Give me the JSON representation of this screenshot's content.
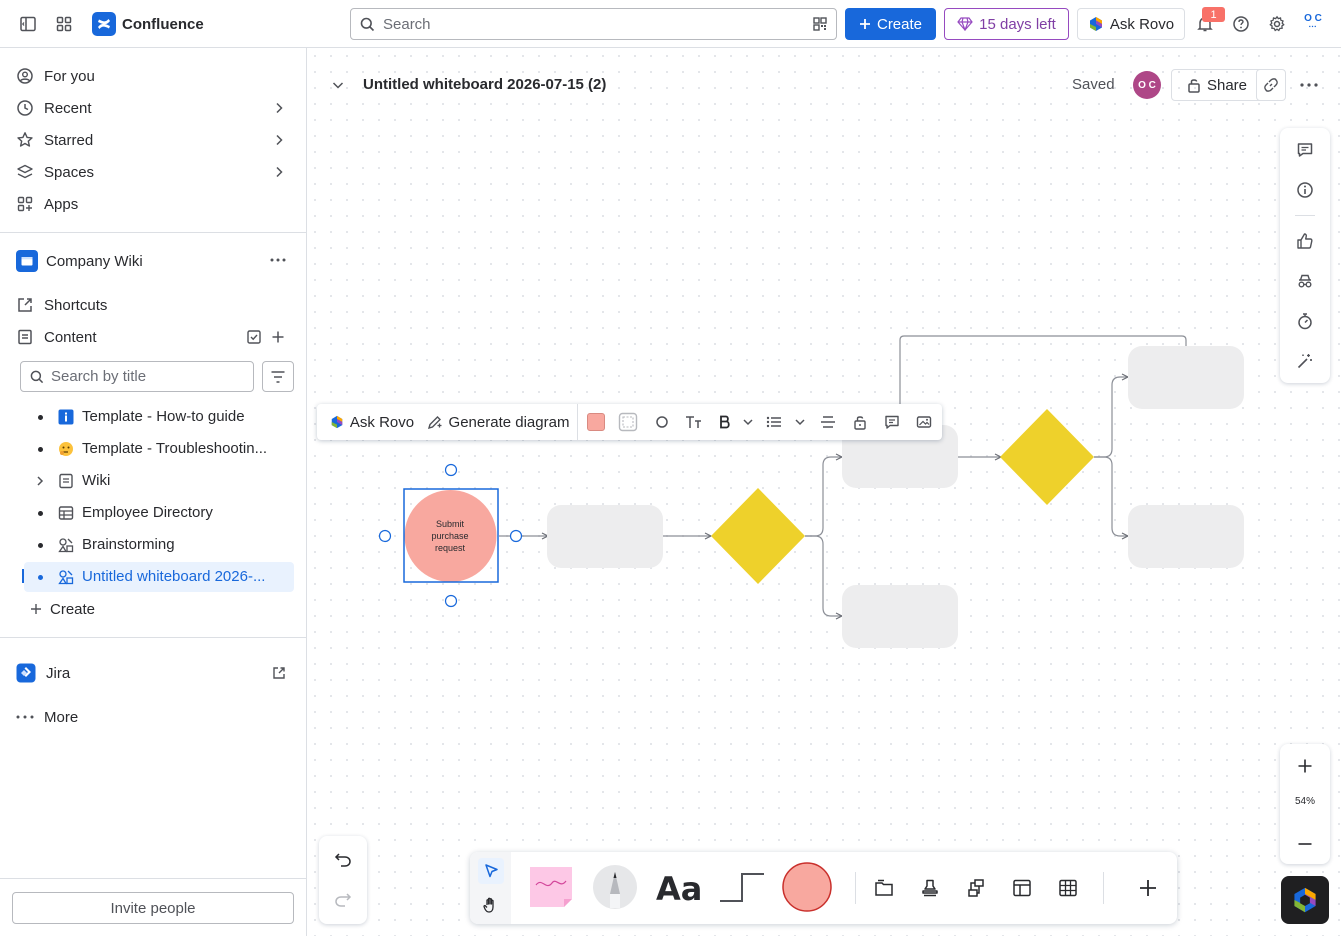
{
  "app": {
    "name": "Confluence"
  },
  "topbar": {
    "search_placeholder": "Search",
    "create_label": "Create",
    "trial_label": "15 days left",
    "ask_rovo_label": "Ask Rovo",
    "notification_count": "1",
    "avatar_initials": "O C"
  },
  "sidebar": {
    "nav": [
      {
        "label": "For you",
        "icon": "user-circle-icon"
      },
      {
        "label": "Recent",
        "icon": "clock-icon"
      },
      {
        "label": "Starred",
        "icon": "star-icon"
      },
      {
        "label": "Spaces",
        "icon": "spaces-icon"
      },
      {
        "label": "Apps",
        "icon": "apps-icon"
      }
    ],
    "space_name": "Company Wiki",
    "shortcuts_label": "Shortcuts",
    "content_label": "Content",
    "search_placeholder": "Search by title",
    "tree": [
      {
        "label": "Template - How-to guide",
        "icon": "info-icon"
      },
      {
        "label": "Template - Troubleshootin...",
        "icon": "emoji-icon"
      },
      {
        "label": "Wiki",
        "icon": "page-icon"
      },
      {
        "label": "Employee Directory",
        "icon": "database-icon"
      },
      {
        "label": "Brainstorming",
        "icon": "whiteboard-icon"
      },
      {
        "label": "Untitled whiteboard 2026-...",
        "icon": "whiteboard-icon"
      }
    ],
    "create_label": "Create",
    "jira_label": "Jira",
    "more_label": "More",
    "invite_label": "Invite people"
  },
  "page": {
    "title": "Untitled whiteboard 2026-07-15 (2)",
    "status": "Saved",
    "collaborator_initials": "O C",
    "share_label": "Share"
  },
  "float_toolbar": {
    "ask_rovo_label": "Ask Rovo",
    "generate_label": "Generate diagram",
    "fill_color": "#f8a89f"
  },
  "diagram": {
    "start_label": "Submit purchase request",
    "circle_color": "#f8a89f",
    "diamond_color": "#eed12b",
    "box_color": "#ededee"
  },
  "zoom": {
    "level": "54%"
  },
  "colors": {
    "accent": "#1868db",
    "sticky": "#fdc8e6"
  }
}
